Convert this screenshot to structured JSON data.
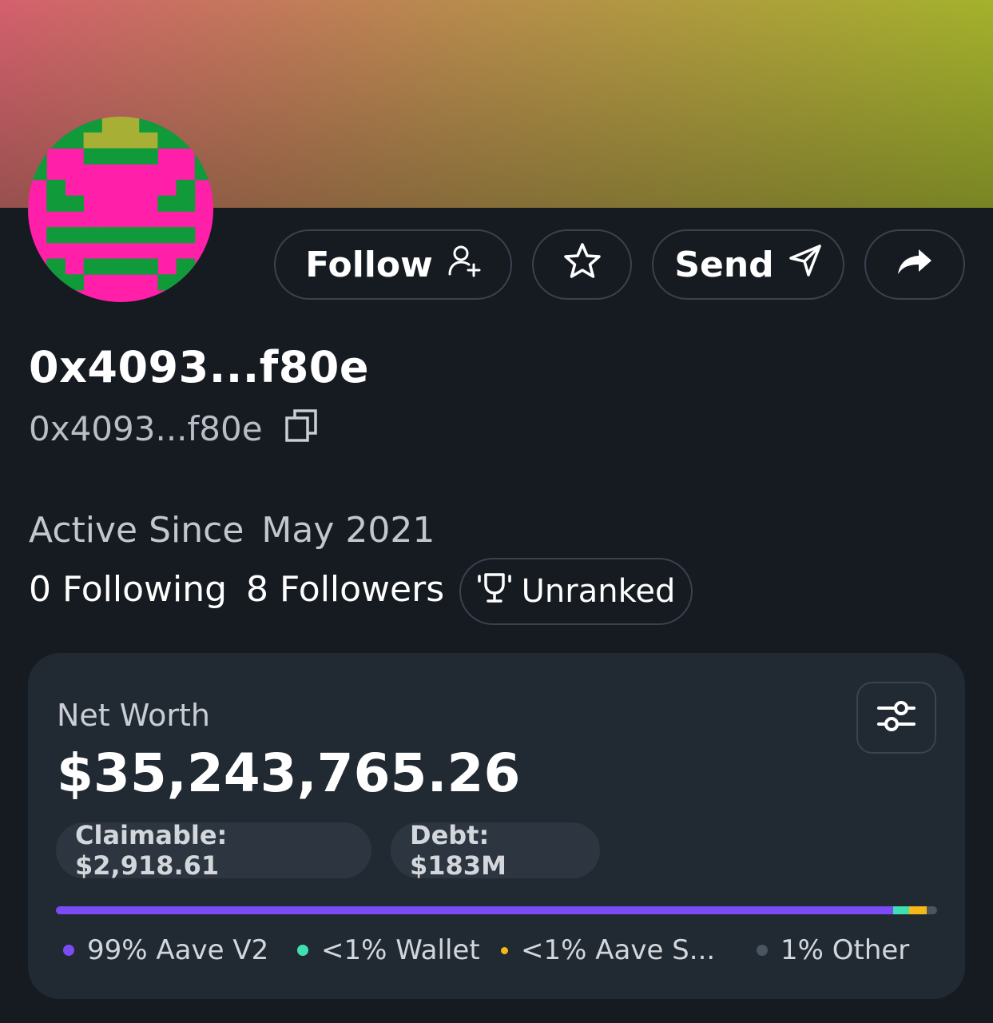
{
  "profile": {
    "title": "0x4093...f80e",
    "subtitle": "0x4093...f80e",
    "active_since_label": "Active Since",
    "active_since_value": "May 2021",
    "following": "0 Following",
    "followers": "8 Followers",
    "rank": "Unranked"
  },
  "actions": {
    "follow_label": "Follow",
    "send_label": "Send",
    "icons": [
      "add-user-icon",
      "star-icon",
      "send-icon",
      "share-icon"
    ]
  },
  "net_worth": {
    "label": "Net Worth",
    "value": "$35,243,765.26",
    "claimable": "Claimable: $2,918.61",
    "debt": "Debt: $183M",
    "breakdown_bar": [
      {
        "name": "Aave V2",
        "fraction": 0.95,
        "color": "#7b4cf5"
      },
      {
        "name": "Wallet",
        "fraction": 0.018,
        "color": "#3ee0b0"
      },
      {
        "name": "Aave S",
        "fraction": 0.02,
        "color": "#f5b814"
      },
      {
        "name": "Other",
        "fraction": 0.012,
        "color": "#4a5562"
      }
    ],
    "legend": [
      {
        "text": "99% Aave V2",
        "color": "#7b4cf5"
      },
      {
        "text": "<1% Wallet",
        "color": "#3ee0b0"
      },
      {
        "text": "<1% Aave S...",
        "color": "#f5b814"
      },
      {
        "text": "1% Other",
        "color": "#4a5562"
      }
    ]
  },
  "colors": {
    "background": "#161b22",
    "card": "#212932",
    "avatar_pink": "#ff1fa8",
    "avatar_green": "#119a3a",
    "avatar_olive": "#a7b034"
  }
}
